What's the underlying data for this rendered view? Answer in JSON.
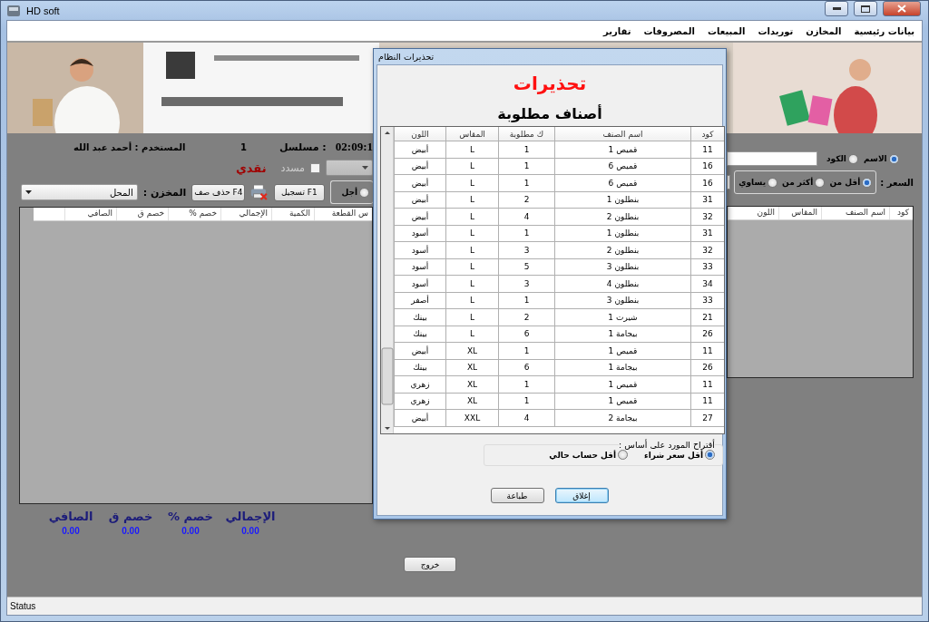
{
  "window": {
    "title": "HD soft"
  },
  "menu": [
    {
      "label": "بيانات رئيسية"
    },
    {
      "label": "المخازن"
    },
    {
      "label": "توريدات"
    },
    {
      "label": "المبيعات"
    },
    {
      "label": "المصروفات"
    },
    {
      "label": "تقارير"
    }
  ],
  "info": {
    "time": "02:09:1",
    "serial_label": "مسلسل :",
    "serial_value": "1",
    "user": "المستخدم : أحمد عبد الله"
  },
  "payment": {
    "paid": {
      "label": "مسدد",
      "checked": false,
      "disabled": true
    },
    "cash_label": "نقدي"
  },
  "payment_type": [
    {
      "label": "أجل",
      "selected": false
    }
  ],
  "buttons": [
    {
      "label": "تسجيل F1"
    },
    {
      "label": "حذف صف F4"
    }
  ],
  "store": {
    "label": "المخزن :",
    "value": "المحل"
  },
  "invoice_grid": {
    "columns": [
      "س القطعة",
      "الكمية",
      "الإجمالي",
      "خصم %",
      "خصم ق",
      "الصافي"
    ]
  },
  "totals": [
    {
      "label": "الإجمالي",
      "value": "0.00"
    },
    {
      "label": "خصم %",
      "value": "0.00"
    },
    {
      "label": "خصم ق",
      "value": "0.00"
    },
    {
      "label": "الصافي",
      "value": "0.00"
    }
  ],
  "search": {
    "modes": [
      {
        "label": "الاسم",
        "selected": true
      },
      {
        "label": "الكود",
        "selected": false
      }
    ]
  },
  "price_filter": {
    "label": "السعر :",
    "options": [
      {
        "label": "أقل من",
        "selected": true
      },
      {
        "label": "أكثر من",
        "selected": false
      },
      {
        "label": "يساوي",
        "selected": false
      }
    ]
  },
  "items_grid": {
    "columns": [
      "كود",
      "اسم الصنف",
      "المقاس",
      "اللون"
    ]
  },
  "exit_button": "خروج",
  "status_bar": "Status",
  "dialog": {
    "title": "تحذيرات النظام",
    "heading": "تحذيرات",
    "subheading": "أصناف مطلوبة",
    "columns": [
      "كود",
      "اسم الصنف",
      "ك مطلوبة",
      "المقاس",
      "اللون"
    ],
    "rows": [
      [
        "11",
        "قميص 1",
        "1",
        "L",
        "أبيض"
      ],
      [
        "16",
        "قميص 6",
        "1",
        "L",
        "أبيض"
      ],
      [
        "16",
        "قميص 6",
        "1",
        "L",
        "أبيض"
      ],
      [
        "31",
        "بنطلون 1",
        "2",
        "L",
        "أبيض"
      ],
      [
        "32",
        "بنطلون 2",
        "4",
        "L",
        "أبيض"
      ],
      [
        "31",
        "بنطلون 1",
        "1",
        "L",
        "أسود"
      ],
      [
        "32",
        "بنطلون 2",
        "3",
        "L",
        "أسود"
      ],
      [
        "33",
        "بنطلون 3",
        "5",
        "L",
        "أسود"
      ],
      [
        "34",
        "بنطلون 4",
        "3",
        "L",
        "أسود"
      ],
      [
        "33",
        "بنطلون 3",
        "1",
        "L",
        "أصفر"
      ],
      [
        "21",
        "شيرت 1",
        "2",
        "L",
        "بينك"
      ],
      [
        "26",
        "بيجامة 1",
        "6",
        "L",
        "بينك"
      ],
      [
        "11",
        "قميص 1",
        "1",
        "XL",
        "أبيض"
      ],
      [
        "26",
        "بيجامة 1",
        "6",
        "XL",
        "بينك"
      ],
      [
        "11",
        "قميص 1",
        "1",
        "XL",
        "زهري"
      ],
      [
        "11",
        "قميص 1",
        "1",
        "XL",
        "زهري"
      ],
      [
        "27",
        "بيجامة 2",
        "4",
        "XXL",
        "أبيض"
      ]
    ],
    "supplier_basis": {
      "label": "أقتراح المورد على أساس :",
      "options": [
        {
          "label": "أقل سعر شراء",
          "selected": true
        },
        {
          "label": "أقل حساب حالي",
          "selected": false
        }
      ]
    },
    "buttons": [
      {
        "label": "إغلاق",
        "focused": true
      },
      {
        "label": "طباعة",
        "focused": false
      }
    ]
  }
}
